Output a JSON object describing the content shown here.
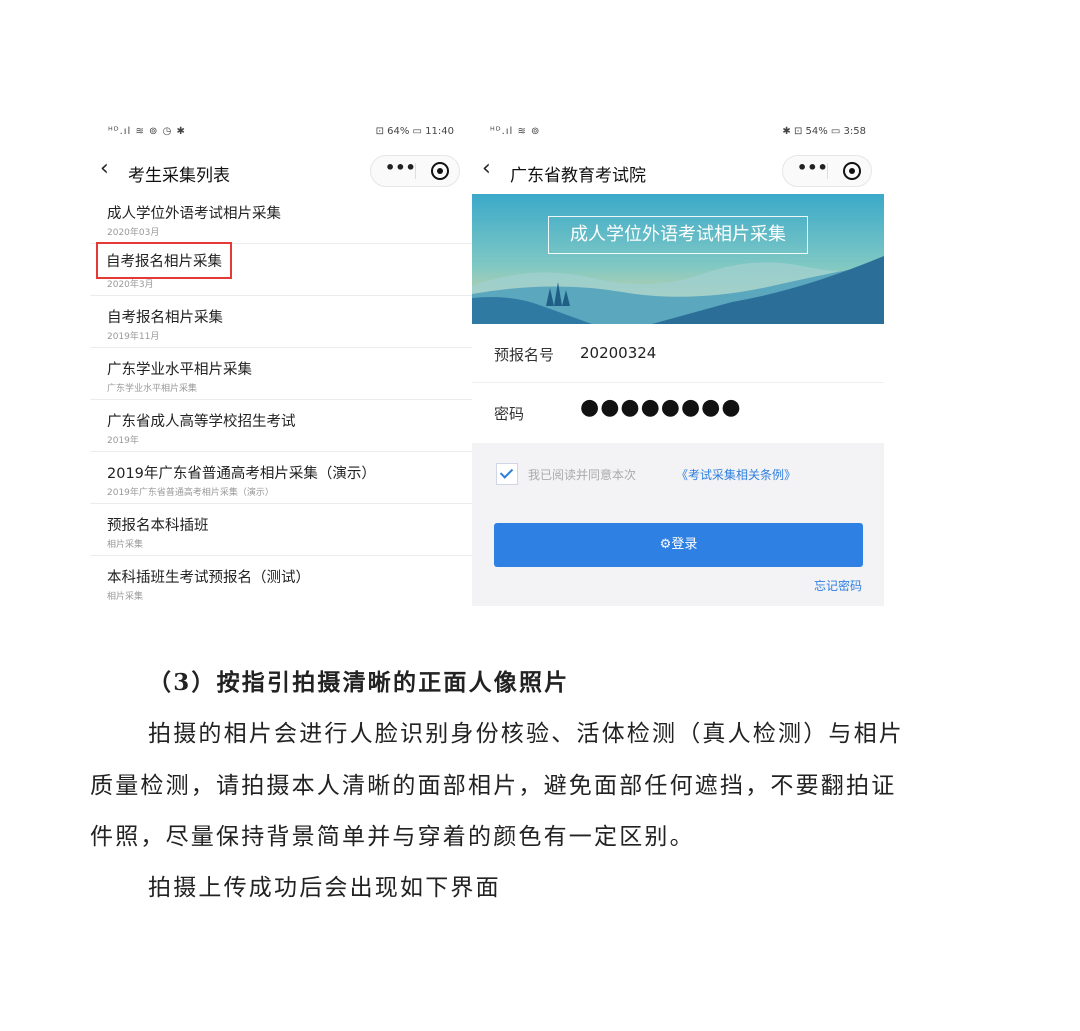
{
  "left_screen": {
    "status_left": "ᴴᴰ.ıl ≋ ⊚ ◷ ✱",
    "status_right": "⊡ 64% ▭ 11:40",
    "title": "考生采集列表",
    "items": [
      {
        "title": "成人学位外语考试相片采集",
        "sub": "2020年03月"
      },
      {
        "title": "自考报名相片采集",
        "sub": "2020年3月",
        "highlighted": true
      },
      {
        "title": "自考报名相片采集",
        "sub": "2019年11月"
      },
      {
        "title": "广东学业水平相片采集",
        "sub": "广东学业水平相片采集"
      },
      {
        "title": "广东省成人高等学校招生考试",
        "sub": "2019年"
      },
      {
        "title": "2019年广东省普通高考相片采集（演示）",
        "sub": "2019年广东省普通高考相片采集（演示）"
      },
      {
        "title": "预报名本科插班",
        "sub": "相片采集"
      },
      {
        "title": "本科插班生考试预报名（测试）",
        "sub": "相片采集"
      }
    ]
  },
  "right_screen": {
    "status_left": "ᴴᴰ.ıl ≋ ⊚",
    "status_right": "✱ ⊡ 54% ▭ 3:58",
    "title": "广东省教育考试院",
    "banner_title": "成人学位外语考试相片采集",
    "form": {
      "reg_label": "预报名号",
      "reg_value": "20200324",
      "pwd_label": "密码",
      "pwd_value": "●●●●●●●●"
    },
    "agree_text": "我已阅读并同意本次",
    "agree_link": "《考试采集相关条例》",
    "login_label": "登录",
    "forgot_label": "忘记密码"
  },
  "document": {
    "heading": "（3）按指引拍摄清晰的正面人像照片",
    "lines": [
      "拍摄的相片会进行人脸识别身份核验、活体检测（真人检测）与相片",
      "质量检测，请拍摄本人清晰的面部相片，避免面部任何遮挡，不要翻拍证",
      "件照，尽量保持背景简单并与穿着的颜色有一定区别。",
      "拍摄上传成功后会出现如下界面"
    ]
  },
  "colors": {
    "accent_blue": "#2f80e3",
    "highlight_red": "#e53935"
  }
}
